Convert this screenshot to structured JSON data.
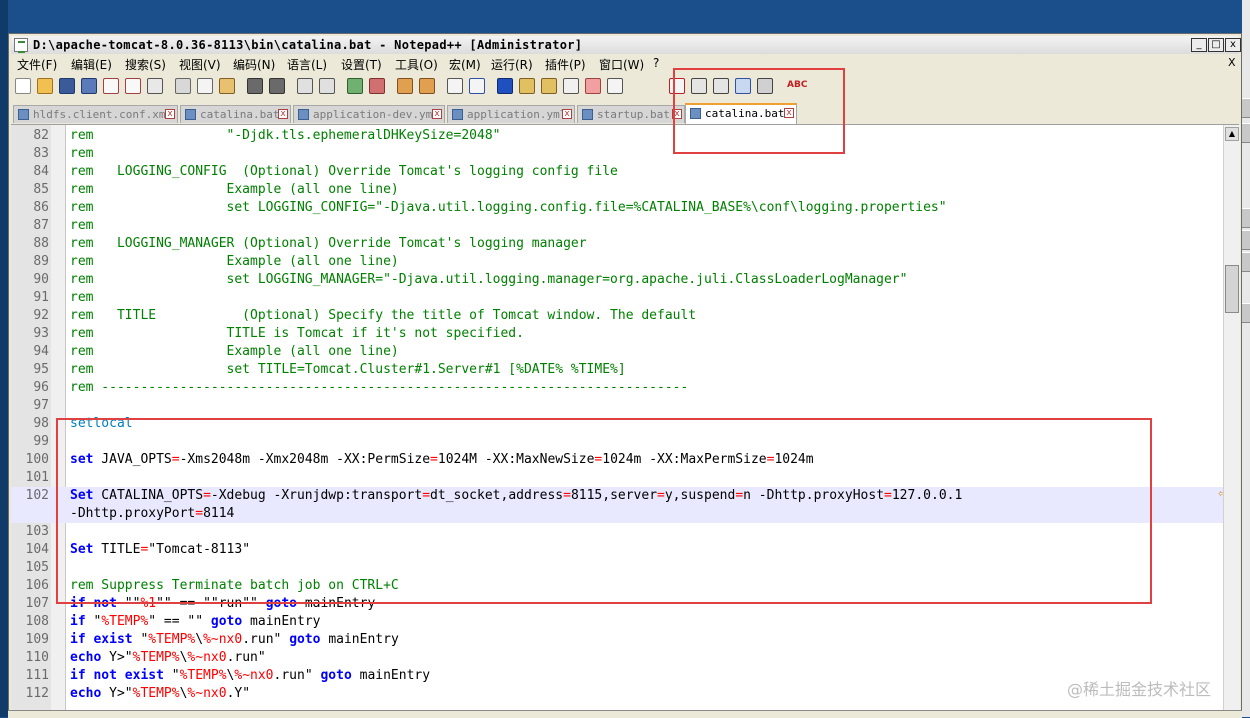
{
  "window": {
    "title": "D:\\apache-tomcat-8.0.36-8113\\bin\\catalina.bat - Notepad++ [Administrator]",
    "buttons": [
      "_",
      "□",
      "x"
    ]
  },
  "menu": {
    "items": [
      "文件(F)",
      "编辑(E)",
      "搜索(S)",
      "视图(V)",
      "编码(N)",
      "语言(L)",
      "设置(T)",
      "工具(O)",
      "宏(M)",
      "运行(R)",
      "插件(P)",
      "窗口(W)",
      "?"
    ],
    "close": "X"
  },
  "toolbar": {
    "spell_check_label": "ABC"
  },
  "tabs": [
    {
      "label": "hldfs.client.conf.xml",
      "active": false
    },
    {
      "label": "catalina.bat",
      "active": false
    },
    {
      "label": "application-dev.yml",
      "active": false
    },
    {
      "label": "application.yml",
      "active": false
    },
    {
      "label": "startup.bat",
      "active": false
    },
    {
      "label": "catalina.bat",
      "active": true
    }
  ],
  "editor": {
    "lines": [
      {
        "n": "82",
        "parts": [
          [
            "cm",
            "rem                 \"-Djdk.tls.ephemeralDHKeySize=2048\""
          ]
        ]
      },
      {
        "n": "83",
        "parts": [
          [
            "cm",
            "rem"
          ]
        ]
      },
      {
        "n": "84",
        "parts": [
          [
            "cm",
            "rem   LOGGING_CONFIG  (Optional) Override Tomcat's logging config file"
          ]
        ]
      },
      {
        "n": "85",
        "parts": [
          [
            "cm",
            "rem                 Example (all one line)"
          ]
        ]
      },
      {
        "n": "86",
        "parts": [
          [
            "cm",
            "rem                 set LOGGING_CONFIG=\"-Djava.util.logging.config.file=%CATALINA_BASE%\\conf\\logging.properties\""
          ]
        ]
      },
      {
        "n": "87",
        "parts": [
          [
            "cm",
            "rem"
          ]
        ]
      },
      {
        "n": "88",
        "parts": [
          [
            "cm",
            "rem   LOGGING_MANAGER (Optional) Override Tomcat's logging manager"
          ]
        ]
      },
      {
        "n": "89",
        "parts": [
          [
            "cm",
            "rem                 Example (all one line)"
          ]
        ]
      },
      {
        "n": "90",
        "parts": [
          [
            "cm",
            "rem                 set LOGGING_MANAGER=\"-Djava.util.logging.manager=org.apache.juli.ClassLoaderLogManager\""
          ]
        ]
      },
      {
        "n": "91",
        "parts": [
          [
            "cm",
            "rem"
          ]
        ]
      },
      {
        "n": "92",
        "parts": [
          [
            "cm",
            "rem   TITLE           (Optional) Specify the title of Tomcat window. The default"
          ]
        ]
      },
      {
        "n": "93",
        "parts": [
          [
            "cm",
            "rem                 TITLE is Tomcat if it's not specified."
          ]
        ]
      },
      {
        "n": "94",
        "parts": [
          [
            "cm",
            "rem                 Example (all one line)"
          ]
        ]
      },
      {
        "n": "95",
        "parts": [
          [
            "cm",
            "rem                 set TITLE=Tomcat.Cluster#1.Server#1 [%DATE% %TIME%]"
          ]
        ]
      },
      {
        "n": "96",
        "parts": [
          [
            "cm",
            "rem ---------------------------------------------------------------------------"
          ]
        ]
      },
      {
        "n": "97",
        "parts": []
      },
      {
        "n": "98",
        "parts": [
          [
            "lbl",
            "setlocal"
          ]
        ]
      },
      {
        "n": "99",
        "parts": []
      },
      {
        "n": "100",
        "parts": [
          [
            "kw",
            "set"
          ],
          [
            "",
            " JAVA_OPTS"
          ],
          [
            "op",
            "="
          ],
          [
            "",
            "-Xms2048m -Xmx2048m -XX:PermSize"
          ],
          [
            "op",
            "="
          ],
          [
            "",
            "1024M -XX:MaxNewSize"
          ],
          [
            "op",
            "="
          ],
          [
            "",
            "1024m -XX:MaxPermSize"
          ],
          [
            "op",
            "="
          ],
          [
            "",
            "1024m"
          ]
        ]
      },
      {
        "n": "101",
        "parts": []
      },
      {
        "n": "102",
        "parts": [
          [
            "kw",
            "Set"
          ],
          [
            "",
            " CATALINA_OPTS"
          ],
          [
            "op",
            "="
          ],
          [
            "",
            "-Xdebug -Xrunjdwp:transport"
          ],
          [
            "op",
            "="
          ],
          [
            "",
            "dt_socket,address"
          ],
          [
            "op",
            "="
          ],
          [
            "",
            "8115,server"
          ],
          [
            "op",
            "="
          ],
          [
            "",
            "y,suspend"
          ],
          [
            "op",
            "="
          ],
          [
            "",
            "n -Dhttp.proxyHost"
          ],
          [
            "op",
            "="
          ],
          [
            "",
            "127.0.0.1"
          ]
        ],
        "hl": true
      },
      {
        "n": "",
        "parts": [
          [
            "",
            "-Dhttp.proxyPort"
          ],
          [
            "op",
            "="
          ],
          [
            "",
            "8114"
          ]
        ],
        "hl": true
      },
      {
        "n": "103",
        "parts": []
      },
      {
        "n": "104",
        "parts": [
          [
            "kw",
            "Set"
          ],
          [
            "",
            " TITLE"
          ],
          [
            "op",
            "="
          ],
          [
            "",
            "\"Tomcat-8113\""
          ]
        ]
      },
      {
        "n": "105",
        "parts": []
      },
      {
        "n": "106",
        "parts": [
          [
            "cm",
            "rem Suppress Terminate batch job on CTRL+C"
          ]
        ]
      },
      {
        "n": "107",
        "parts": [
          [
            "kw",
            "if not"
          ],
          [
            "",
            " \"\""
          ],
          [
            "var",
            "%1"
          ],
          [
            "",
            "\"\" == \"\"run\"\" "
          ],
          [
            "kw",
            "goto"
          ],
          [
            "",
            " mainEntry"
          ]
        ]
      },
      {
        "n": "108",
        "parts": [
          [
            "kw",
            "if"
          ],
          [
            "",
            " \""
          ],
          [
            "var",
            "%TEMP%"
          ],
          [
            "",
            "\" == \"\" "
          ],
          [
            "kw",
            "goto"
          ],
          [
            "",
            " mainEntry"
          ]
        ]
      },
      {
        "n": "109",
        "parts": [
          [
            "kw",
            "if exist"
          ],
          [
            "",
            " \""
          ],
          [
            "var",
            "%TEMP%"
          ],
          [
            "",
            "\\"
          ],
          [
            "var",
            "%~nx0"
          ],
          [
            "",
            ".run\" "
          ],
          [
            "kw",
            "goto"
          ],
          [
            "",
            " mainEntry"
          ]
        ]
      },
      {
        "n": "110",
        "parts": [
          [
            "kw",
            "echo"
          ],
          [
            "",
            " Y>\""
          ],
          [
            "var",
            "%TEMP%"
          ],
          [
            "",
            "\\"
          ],
          [
            "var",
            "%~nx0"
          ],
          [
            "",
            ".run\""
          ]
        ]
      },
      {
        "n": "111",
        "parts": [
          [
            "kw",
            "if not exist"
          ],
          [
            "",
            " \""
          ],
          [
            "var",
            "%TEMP%"
          ],
          [
            "",
            "\\"
          ],
          [
            "var",
            "%~nx0"
          ],
          [
            "",
            ".run\" "
          ],
          [
            "kw",
            "goto"
          ],
          [
            "",
            " mainEntry"
          ]
        ]
      },
      {
        "n": "112",
        "parts": [
          [
            "kw",
            "echo"
          ],
          [
            "",
            " Y>\""
          ],
          [
            "var",
            "%TEMP%"
          ],
          [
            "",
            "\\"
          ],
          [
            "var",
            "%~nx0"
          ],
          [
            "",
            ".Y\""
          ]
        ]
      }
    ]
  },
  "watermark": "@稀土掘金技术社区",
  "colors": {
    "comment": "#008000",
    "keyword": "#0000ff",
    "variable": "#ff0000",
    "highlight_box": "#e04040",
    "current_line": "#e8e8ff"
  }
}
